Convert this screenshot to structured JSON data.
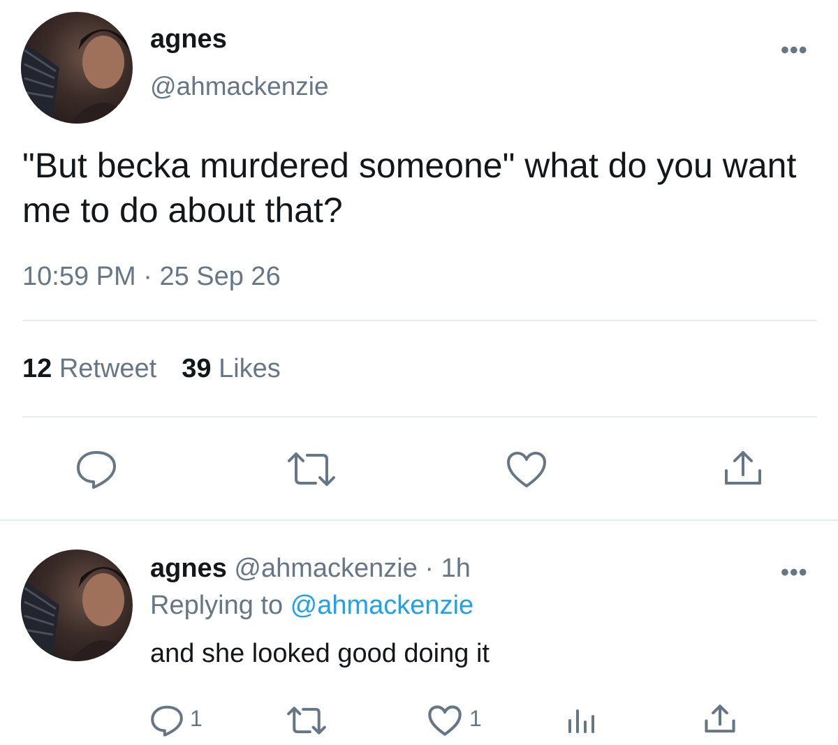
{
  "tweet": {
    "author_name": "agnes",
    "author_handle": "@ahmackenzie",
    "text": "\"But becka murdered someone\" what do you want me to do about that?",
    "time": "10:59 PM",
    "date_sep": " · ",
    "date": "25 Sep 26",
    "retweet_count": "12",
    "retweet_label": " Retweet",
    "like_count": "39",
    "like_label": " Likes",
    "actions": [
      "reply-icon",
      "retweet-icon",
      "like-icon",
      "share-icon"
    ]
  },
  "reply": {
    "author_name": "agnes",
    "author_handle": " @ahmackenzie",
    "time_sep": " · ",
    "time": "1h",
    "replying_prefix": "Replying to ",
    "replying_to": "@ahmackenzie",
    "text": "and she looked good doing it",
    "reply_count": "1",
    "like_count": "1",
    "actions": [
      "reply-icon",
      "retweet-icon",
      "like-icon",
      "analytics-icon",
      "share-icon"
    ]
  },
  "colors": {
    "text": "#14171a",
    "secondary": "#657786",
    "link": "#1da1f2",
    "divider": "#e6ecf0"
  }
}
